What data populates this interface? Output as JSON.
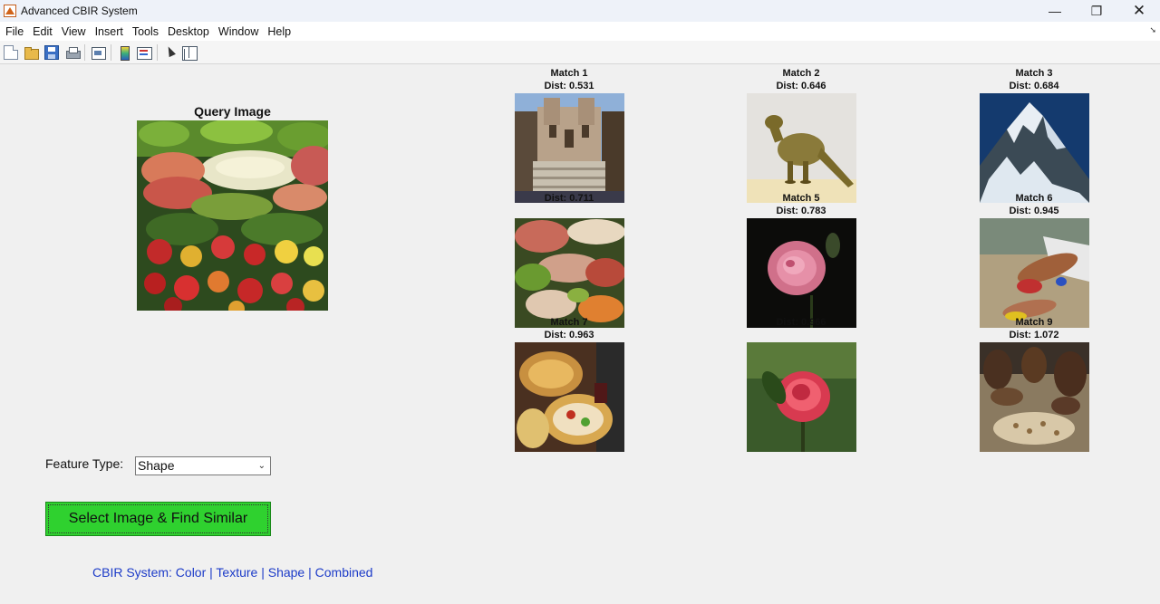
{
  "window": {
    "title": "Advanced CBIR System",
    "controls": {
      "minimize": "—",
      "maximize": "❐",
      "close": "✕"
    }
  },
  "menu": {
    "items": [
      "File",
      "Edit",
      "View",
      "Insert",
      "Tools",
      "Desktop",
      "Window",
      "Help"
    ]
  },
  "toolbar": {
    "buttons": [
      {
        "name": "new-figure",
        "icon": "new-file-icon"
      },
      {
        "name": "open-file",
        "icon": "folder-open-icon"
      },
      {
        "name": "save-figure",
        "icon": "save-icon"
      },
      {
        "name": "print-figure",
        "icon": "print-icon"
      },
      {
        "name": "print-preview",
        "icon": "print-preview-icon"
      },
      {
        "name": "insert-colorbar",
        "icon": "colorbar-icon"
      },
      {
        "name": "insert-legend",
        "icon": "legend-icon"
      },
      {
        "name": "edit-plot",
        "icon": "pointer-icon"
      },
      {
        "name": "property-inspector",
        "icon": "inspector-icon"
      }
    ]
  },
  "query": {
    "title": "Query Image"
  },
  "matches": [
    {
      "label": "Match 1",
      "dist": "Dist: 0.531",
      "scene": "architecture"
    },
    {
      "label": "Match 2",
      "dist": "Dist: 0.646",
      "scene": "dinosaur"
    },
    {
      "label": "Match 3",
      "dist": "Dist: 0.684",
      "scene": "mountain"
    },
    {
      "label": "",
      "dist": "Dist: 0.711",
      "scene": "food"
    },
    {
      "label": "Match 5",
      "dist": "Dist: 0.783",
      "scene": "flower"
    },
    {
      "label": "Match 6",
      "dist": "Dist: 0.945",
      "scene": "beach"
    },
    {
      "label": "Match 7",
      "dist": "Dist: 0.963",
      "scene": "food"
    },
    {
      "label": "",
      "dist": "Dist: 0.966",
      "scene": "flower"
    },
    {
      "label": "Match 9",
      "dist": "Dist: 1.072",
      "scene": "people"
    }
  ],
  "controls": {
    "feature_label": "Feature Type:",
    "feature_value": "Shape",
    "find_button": "Select Image & Find Similar",
    "footer": "CBIR System: Color | Texture | Shape | Combined"
  },
  "colors": {
    "find_button": "#2fd12f",
    "footer_text": "#1c3bc8",
    "background": "#f0f0f0"
  }
}
